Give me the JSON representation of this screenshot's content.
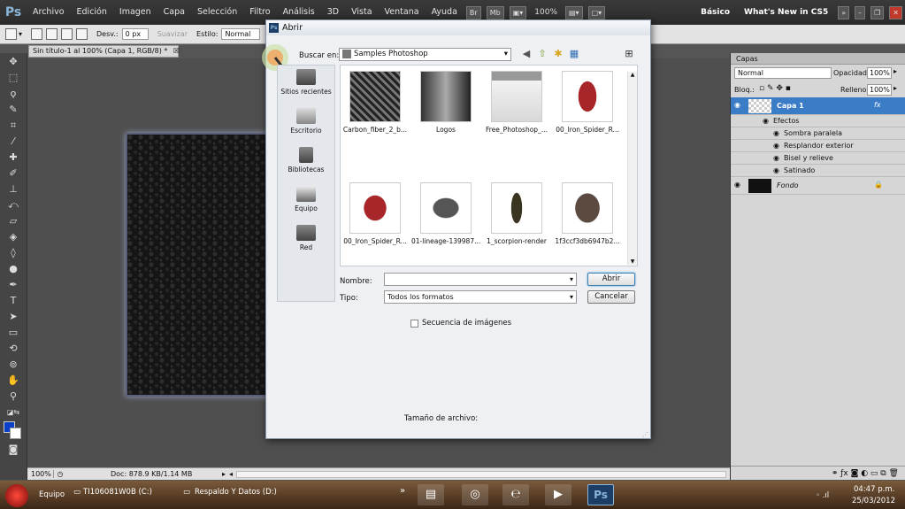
{
  "menubar": {
    "logo": "Ps",
    "items": [
      "Archivo",
      "Edición",
      "Imagen",
      "Capa",
      "Selección",
      "Filtro",
      "Análisis",
      "3D",
      "Vista",
      "Ventana",
      "Ayuda"
    ],
    "bridge": "Br",
    "minibridge": "Mb",
    "zoom": "100%",
    "workspace": "Básico",
    "whats_new": "What's New in CS5"
  },
  "options": {
    "feather_label": "Desv.:",
    "feather_value": "0 px",
    "smooth_label": "Suavizar",
    "style_label": "Estilo:",
    "style_value": "Normal"
  },
  "document": {
    "tab": "Sin título-1 al 100% (Capa 1, RGB/8) *",
    "zoom": "100%",
    "doc_info": "Doc: 878.9 KB/1.14 MB"
  },
  "dialog": {
    "title": "Abrir",
    "lookin_label": "Buscar en:",
    "lookin_value": "Samples Photoshop",
    "places": [
      "Sitios recientes",
      "Escritorio",
      "Bibliotecas",
      "Equipo",
      "Red"
    ],
    "files": [
      "Carbon_fiber_2_b...",
      "Logos",
      "Free_Photoshop_...",
      "00_Iron_Spider_R...",
      "00_Iron_Spider_R...",
      "01-lineage-139987...",
      "1_scorpion-render",
      "1f3ccf3db6947b2..."
    ],
    "name_label": "Nombre:",
    "type_label": "Tipo:",
    "type_value": "Todos los formatos",
    "open_button": "Abrir",
    "cancel_button": "Cancelar",
    "sequence_label": "Secuencia de imágenes",
    "filesize_label": "Tamaño de archivo:"
  },
  "panel": {
    "tab": "Capas",
    "blend_mode": "Normal",
    "opacity_label": "Opacidad:",
    "opacity_value": "100%",
    "lock_label": "Bloq.:",
    "fill_label": "Relleno:",
    "fill_value": "100%",
    "layer1_name": "Capa 1",
    "layer1_fx": "fx",
    "effects_label": "Efectos",
    "effects": [
      "Sombra paralela",
      "Resplandor exterior",
      "Bisel y relieve",
      "Satinado"
    ],
    "background_name": "Fondo"
  },
  "taskbar": {
    "items": [
      "Equipo",
      "TI106081W0B (C:)",
      "Respaldo Y Datos (D:)"
    ],
    "time": "04:47 p.m.",
    "date": "25/03/2012"
  }
}
